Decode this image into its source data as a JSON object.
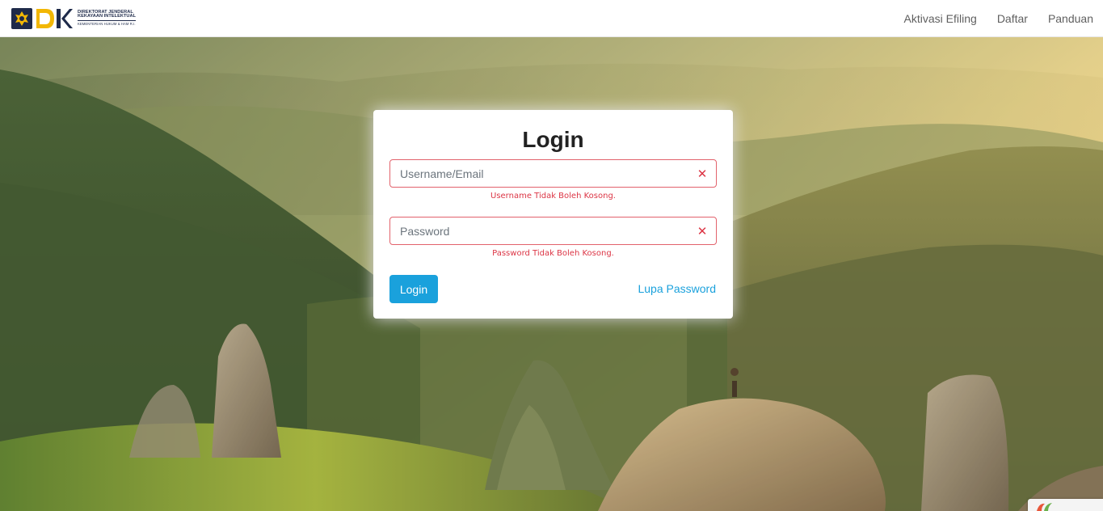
{
  "brand": {
    "line1": "DIREKTORAT JENDERAL",
    "line2": "KEKAYAAN INTELEKTUAL",
    "line3": "KEMENTERIAN HUKUM & HAM R.I."
  },
  "nav": {
    "items": [
      {
        "label": "Aktivasi Efiling"
      },
      {
        "label": "Daftar"
      },
      {
        "label": "Panduan"
      }
    ]
  },
  "login": {
    "title": "Login",
    "username": {
      "placeholder": "Username/Email",
      "value": "",
      "error": "Username Tidak Boleh Kosong."
    },
    "password": {
      "placeholder": "Password",
      "value": "",
      "error": "Password Tidak Boleh Kosong."
    },
    "submit_label": "Login",
    "forgot_label": "Lupa Password",
    "error_icon": "✕"
  },
  "colors": {
    "accent": "#1aa1dc",
    "error": "#dc3545",
    "brand_navy": "#1e2a4a",
    "brand_gold": "#f2b705"
  },
  "icons": {
    "emblem": "garuda-emblem-icon",
    "field_error": "close-icon",
    "recaptcha": "recaptcha-icon"
  }
}
